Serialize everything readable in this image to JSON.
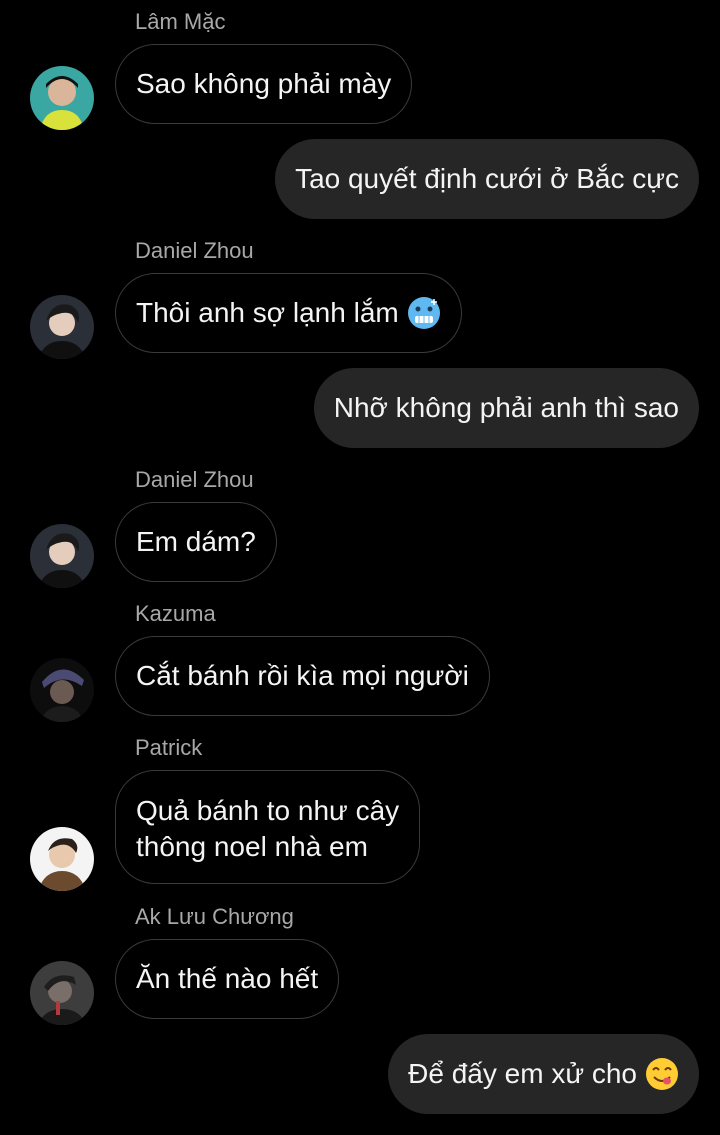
{
  "messages": [
    {
      "sender": "Lâm Mặc",
      "text": "Sao không phải mày"
    },
    {
      "sender": "me",
      "text": "Tao quyết định cưới ở Bắc cực"
    },
    {
      "sender": "Daniel Zhou",
      "text": "Thôi anh sợ lạnh lắm",
      "emoji": "cold-face-emoji"
    },
    {
      "sender": "me",
      "text": "Nhỡ không phải anh thì sao"
    },
    {
      "sender": "Daniel Zhou",
      "text": "Em dám?"
    },
    {
      "sender": "Kazuma",
      "text": "Cắt bánh rồi kìa mọi người"
    },
    {
      "sender": "Patrick",
      "lines": [
        "Quả bánh to như cây",
        "thông noel nhà em"
      ]
    },
    {
      "sender": "Ak Lưu Chương",
      "text": "Ăn thế nào hết"
    },
    {
      "sender": "me",
      "text": "Để đấy em xử cho",
      "emoji": "savoring-food-face-emoji"
    }
  ],
  "colors": {
    "background": "#000000",
    "outgoing_bubble": "#262626",
    "incoming_border": "#3a3a3a",
    "sender_name": "#a8a8a8",
    "text": "#f4f4f4"
  }
}
